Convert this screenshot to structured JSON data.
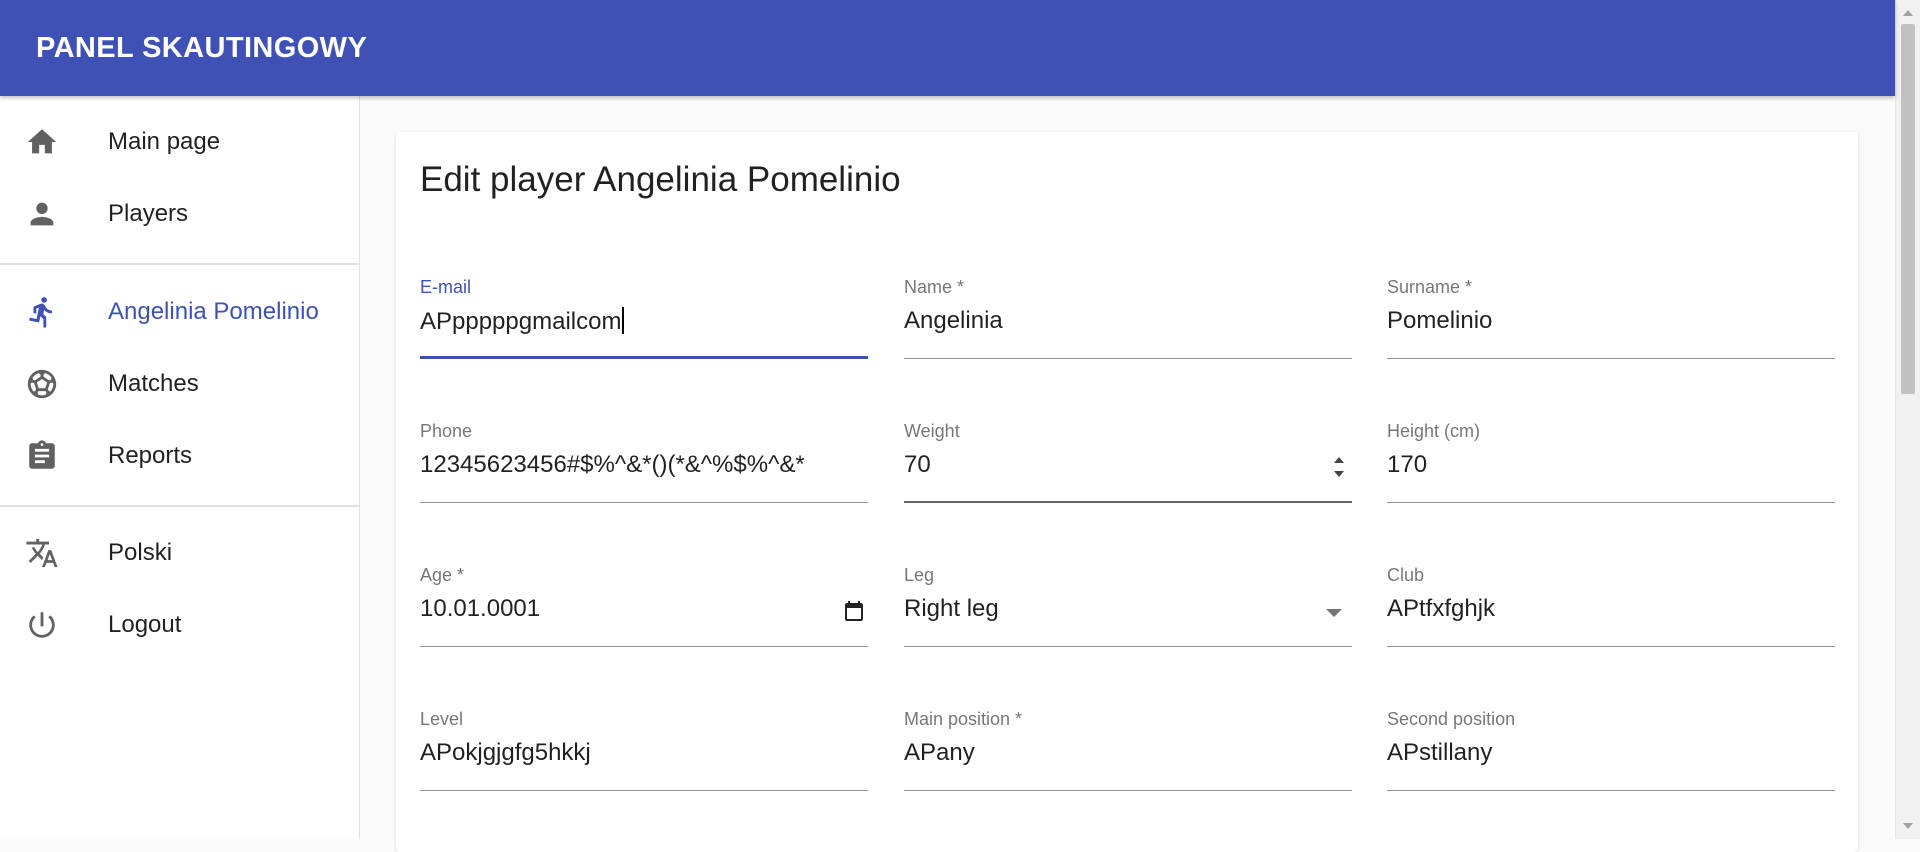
{
  "app": {
    "title": "PANEL SKAUTINGOWY"
  },
  "sidebar": {
    "items": [
      {
        "label": "Main page",
        "icon": "home-icon"
      },
      {
        "label": "Players",
        "icon": "person-icon"
      },
      {
        "label": "Angelinia Pomelinio",
        "icon": "running-icon",
        "active": true
      },
      {
        "label": "Matches",
        "icon": "soccer-ball-icon"
      },
      {
        "label": "Reports",
        "icon": "clipboard-icon"
      },
      {
        "label": "Polski",
        "icon": "translate-icon"
      },
      {
        "label": "Logout",
        "icon": "power-icon"
      }
    ]
  },
  "form": {
    "title": "Edit player Angelinia Pomelinio",
    "fields": {
      "email": {
        "label": "E-mail",
        "value": "APpppppgmailcom"
      },
      "name": {
        "label": "Name *",
        "value": "Angelinia"
      },
      "surname": {
        "label": "Surname *",
        "value": "Pomelinio"
      },
      "phone": {
        "label": "Phone",
        "value": "12345623456#$%^&*()(*&^%$%^&*"
      },
      "weight": {
        "label": "Weight",
        "value": "70"
      },
      "height": {
        "label": "Height (cm)",
        "value": "170"
      },
      "age": {
        "label": "Age *",
        "value": "10.01.0001"
      },
      "leg": {
        "label": "Leg",
        "value": "Right leg"
      },
      "club": {
        "label": "Club",
        "value": "APtfxfghjk"
      },
      "level": {
        "label": "Level",
        "value": "APokjgjgfg5hkkj"
      },
      "main_position": {
        "label": "Main position *",
        "value": "APany"
      },
      "second_position": {
        "label": "Second position",
        "value": "APstillany"
      }
    }
  },
  "colors": {
    "primary": "#3f51b5",
    "background": "#fafafa"
  }
}
